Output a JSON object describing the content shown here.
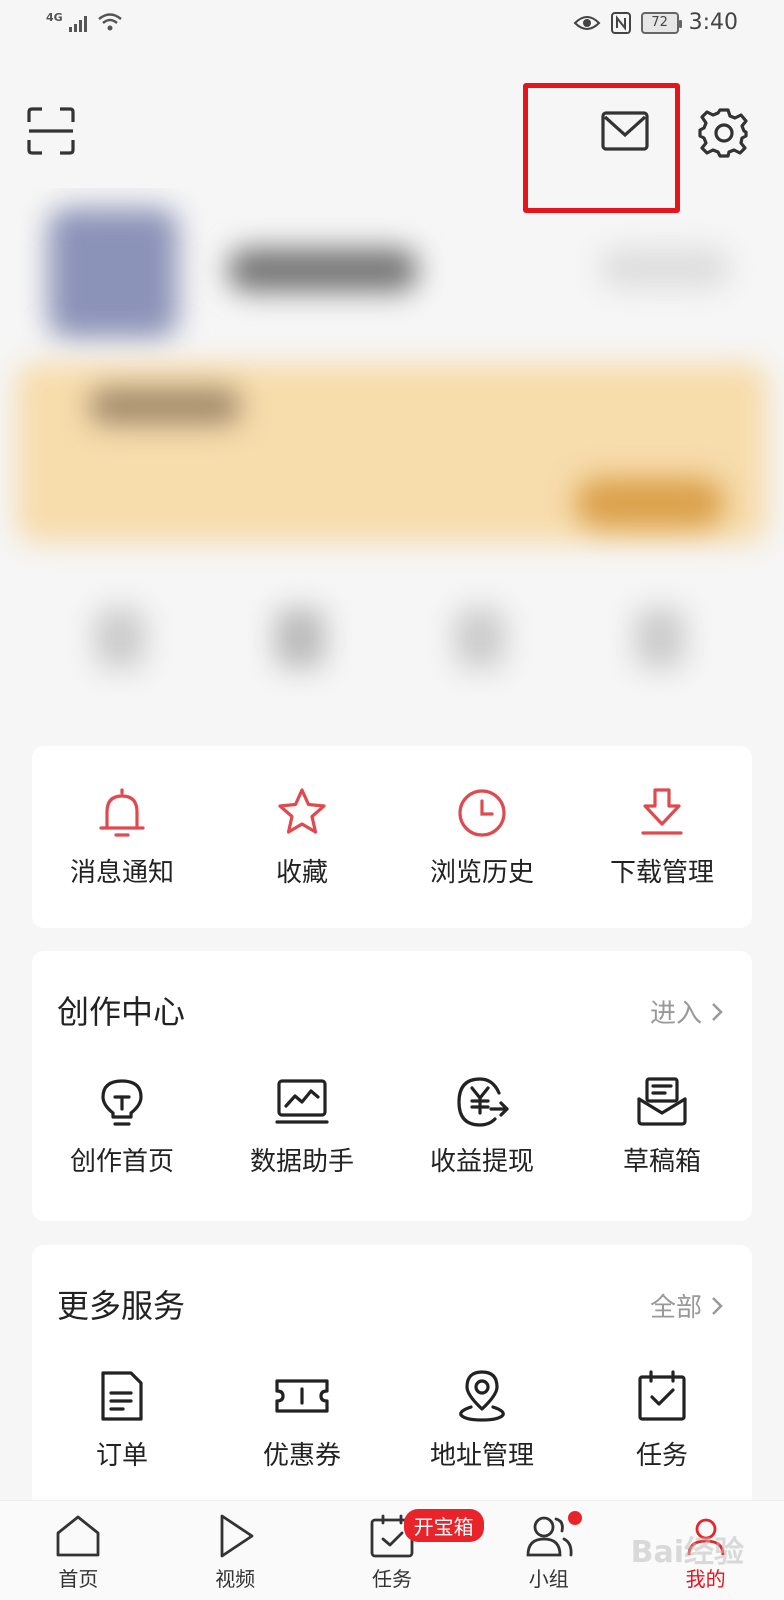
{
  "status_bar": {
    "network": "4G",
    "battery": "72",
    "time": "3:40",
    "icons": [
      "signal-icon",
      "wifi-icon",
      "eye-icon",
      "nfc-icon",
      "battery-icon"
    ]
  },
  "header": {
    "icons": [
      "scan-icon",
      "mail-icon",
      "gear-icon"
    ]
  },
  "quick_actions": [
    {
      "label": "消息通知",
      "icon": "bell-icon"
    },
    {
      "label": "收藏",
      "icon": "star-icon"
    },
    {
      "label": "浏览历史",
      "icon": "clock-icon"
    },
    {
      "label": "下载管理",
      "icon": "download-icon"
    }
  ],
  "creator_center": {
    "title": "创作中心",
    "link": "进入",
    "items": [
      {
        "label": "创作首页",
        "icon": "lightbulb-icon"
      },
      {
        "label": "数据助手",
        "icon": "chart-icon"
      },
      {
        "label": "收益提现",
        "icon": "yuan-withdraw-icon"
      },
      {
        "label": "草稿箱",
        "icon": "draft-box-icon"
      }
    ]
  },
  "more_services": {
    "title": "更多服务",
    "link": "全部",
    "items": [
      {
        "label": "订单",
        "icon": "order-icon"
      },
      {
        "label": "优惠券",
        "icon": "coupon-icon"
      },
      {
        "label": "地址管理",
        "icon": "location-icon"
      },
      {
        "label": "任务",
        "icon": "task-calendar-icon"
      }
    ]
  },
  "bottom_nav": {
    "items": [
      {
        "label": "首页",
        "icon": "home-icon"
      },
      {
        "label": "视频",
        "icon": "play-icon"
      },
      {
        "label": "任务",
        "icon": "task-icon",
        "badge": "开宝箱"
      },
      {
        "label": "小组",
        "icon": "group-icon"
      },
      {
        "label": "我的",
        "icon": "profile-icon",
        "active": true
      }
    ],
    "watermark": "Bai经验"
  },
  "colors": {
    "accent": "#e8242a",
    "highlight": "#e8141c",
    "icon_red": "#e04a4e"
  }
}
